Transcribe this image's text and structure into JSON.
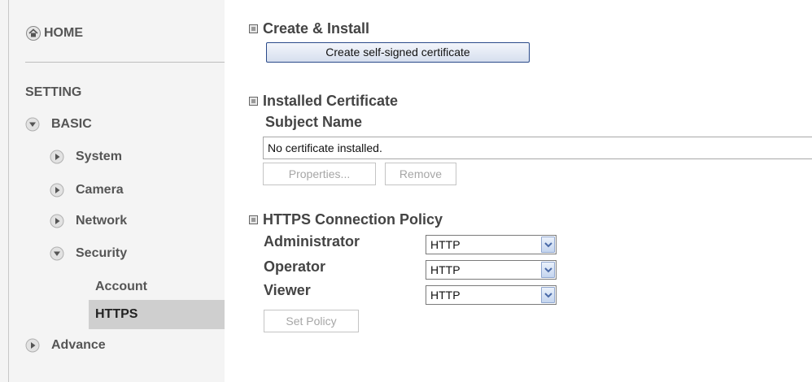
{
  "sidebar": {
    "home": {
      "label": "HOME",
      "icon": "home-icon"
    },
    "setting_label": "SETTING",
    "items": [
      {
        "label": "BASIC",
        "state": "expanded"
      },
      {
        "label": "System",
        "state": "collapsed"
      },
      {
        "label": "Camera",
        "state": "collapsed"
      },
      {
        "label": "Network",
        "state": "collapsed"
      },
      {
        "label": "Security",
        "state": "expanded"
      },
      {
        "label": "Account",
        "state": "leaf"
      },
      {
        "label": "HTTPS",
        "state": "active"
      },
      {
        "label": "Advance",
        "state": "collapsed"
      }
    ]
  },
  "sections": {
    "create": {
      "title": "Create & Install",
      "button_label": "Create self-signed certificate"
    },
    "installed": {
      "title": "Installed Certificate",
      "subject_label": "Subject Name",
      "subject_value": "No certificate installed.",
      "properties_label": "Properties...",
      "remove_label": "Remove"
    },
    "policy": {
      "title": "HTTPS Connection Policy",
      "rows": [
        {
          "label": "Administrator",
          "value": "HTTP"
        },
        {
          "label": "Operator",
          "value": "HTTP"
        },
        {
          "label": "Viewer",
          "value": "HTTP"
        }
      ],
      "set_policy_label": "Set Policy"
    }
  },
  "colors": {
    "sidebar_bg": "#f4f4f4",
    "active_bg": "#cfcfcf",
    "button_border": "#2a4a8a",
    "text": "#444444"
  }
}
